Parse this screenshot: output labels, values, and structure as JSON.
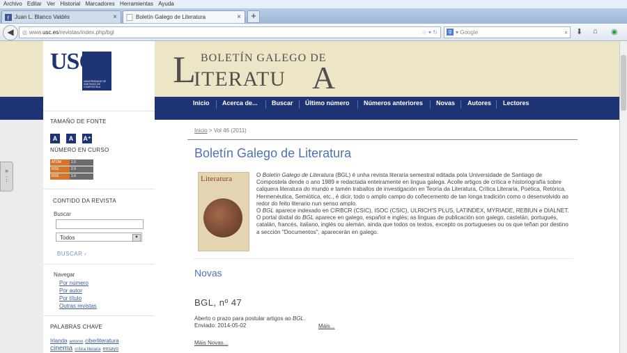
{
  "browser": {
    "menu": [
      "Archivo",
      "Editar",
      "Ver",
      "Historial",
      "Marcadores",
      "Herramientas",
      "Ayuda"
    ],
    "tabs": [
      {
        "label": "Juan L. Blanco Valdés"
      },
      {
        "label": "Boletín Galego de Literatura"
      }
    ],
    "new_tab": "+",
    "url": {
      "prefix": "www.",
      "domain": "usc.es",
      "path": "/revistas/index.php/bgl"
    },
    "search_placeholder": "Google"
  },
  "site": {
    "usc_logo": {
      "text": "USC",
      "subtitle": "UNIVERSIDADE DE SANTIAGO DE COMPOSTELA"
    },
    "journal_logo": {
      "top": "BOLETÍN GALEGO DE",
      "L": "L",
      "middle": "ITERATU",
      "A": "A"
    },
    "nav": [
      "Inicio",
      "Acerca de...",
      "Buscar",
      "Último número",
      "Números anteriores",
      "Novas",
      "Autores",
      "Lectores"
    ]
  },
  "sidebar": {
    "font_size_title": "TAMAÑO DE FONTE",
    "font_buttons": [
      "A",
      "A",
      "A⁺"
    ],
    "current_issue_title": "NÚMERO EN CURSO",
    "feeds": [
      {
        "label": "ATOM",
        "version": "1.0"
      },
      {
        "label": "RSS",
        "version": "2.0"
      },
      {
        "label": "RSS",
        "version": "1.0"
      }
    ],
    "contents_title": "CONTIDO DA REVISTA",
    "search_label": "Buscar",
    "search_select": "Todos",
    "search_button": "BUSCAR",
    "browse_label": "Navegar",
    "browse_links": [
      "Por número",
      "Por autor",
      "Por título",
      "Outras revistas"
    ],
    "keywords_title": "PALABRAS CHAVE",
    "keywords": [
      "Irlanda",
      "antonio",
      "ciberliteratura",
      "cinema",
      "crítica literaria",
      "ensayo"
    ]
  },
  "content": {
    "breadcrumb": {
      "home": "Inicio",
      "sep": " > ",
      "current": "Vol 46 (2011)"
    },
    "journal_title": "Boletín Galego de Literatura",
    "cover_title": "Literatura",
    "description": {
      "p1_pre": "O ",
      "p1_italic": "Boletín Galego de Literatura",
      "p1_post": " (BGL) é unha revista literaria semestral editada pola Universidade de Santiago de Compostela dende o ano 1989 e redactada enteiramente en lingua galega. Acolle artigos de crítica e historiografía sobre calquera literatura do mundo e tamén traballos de investigación en Teoría da Literatura, Crítica Literaria, Poética, Retórica, Hermenéutica, Semiótica, etc., é dicir, todo o amplo campo do coñecemento de tan longa tradición como o desenvolvido ao redor do feito literario nun senso amplo.",
      "p2_pre": "O ",
      "p2_italic": "BGL",
      "p2_post": " aparece indexado en CIRBCR (CSIC), ISOC (CSIC), ULRICH'S PLUS, LATINDEX, MYRIADE, REBIUN e DIALNET.",
      "p3_pre": "O portal dixital do ",
      "p3_italic": "BGL",
      "p3_post": " aparece en galego, español e inglés; as linguas de publicación son galego, castelán, portugués, catalán, francés, italiano, inglés ou alemán, ainda que todos os textos, excepto os portugueses ou os que teñan por destino a sección \"Documentos\", aparecerán en galego."
    },
    "news_heading": "Novas",
    "news_item": {
      "title": "BGL, nº 47",
      "text_pre": "Aberto o prazo para postular artigos ao ",
      "text_italic": "BGL",
      "text_post": ".",
      "date": "Enviado: 2014-05-02",
      "more": "Máis..."
    },
    "more_news": "Máis Novas..."
  },
  "colors": {
    "brand_blue": "#1e3374",
    "header_beige": "#ede6c6",
    "link_blue": "#4b73b3"
  }
}
